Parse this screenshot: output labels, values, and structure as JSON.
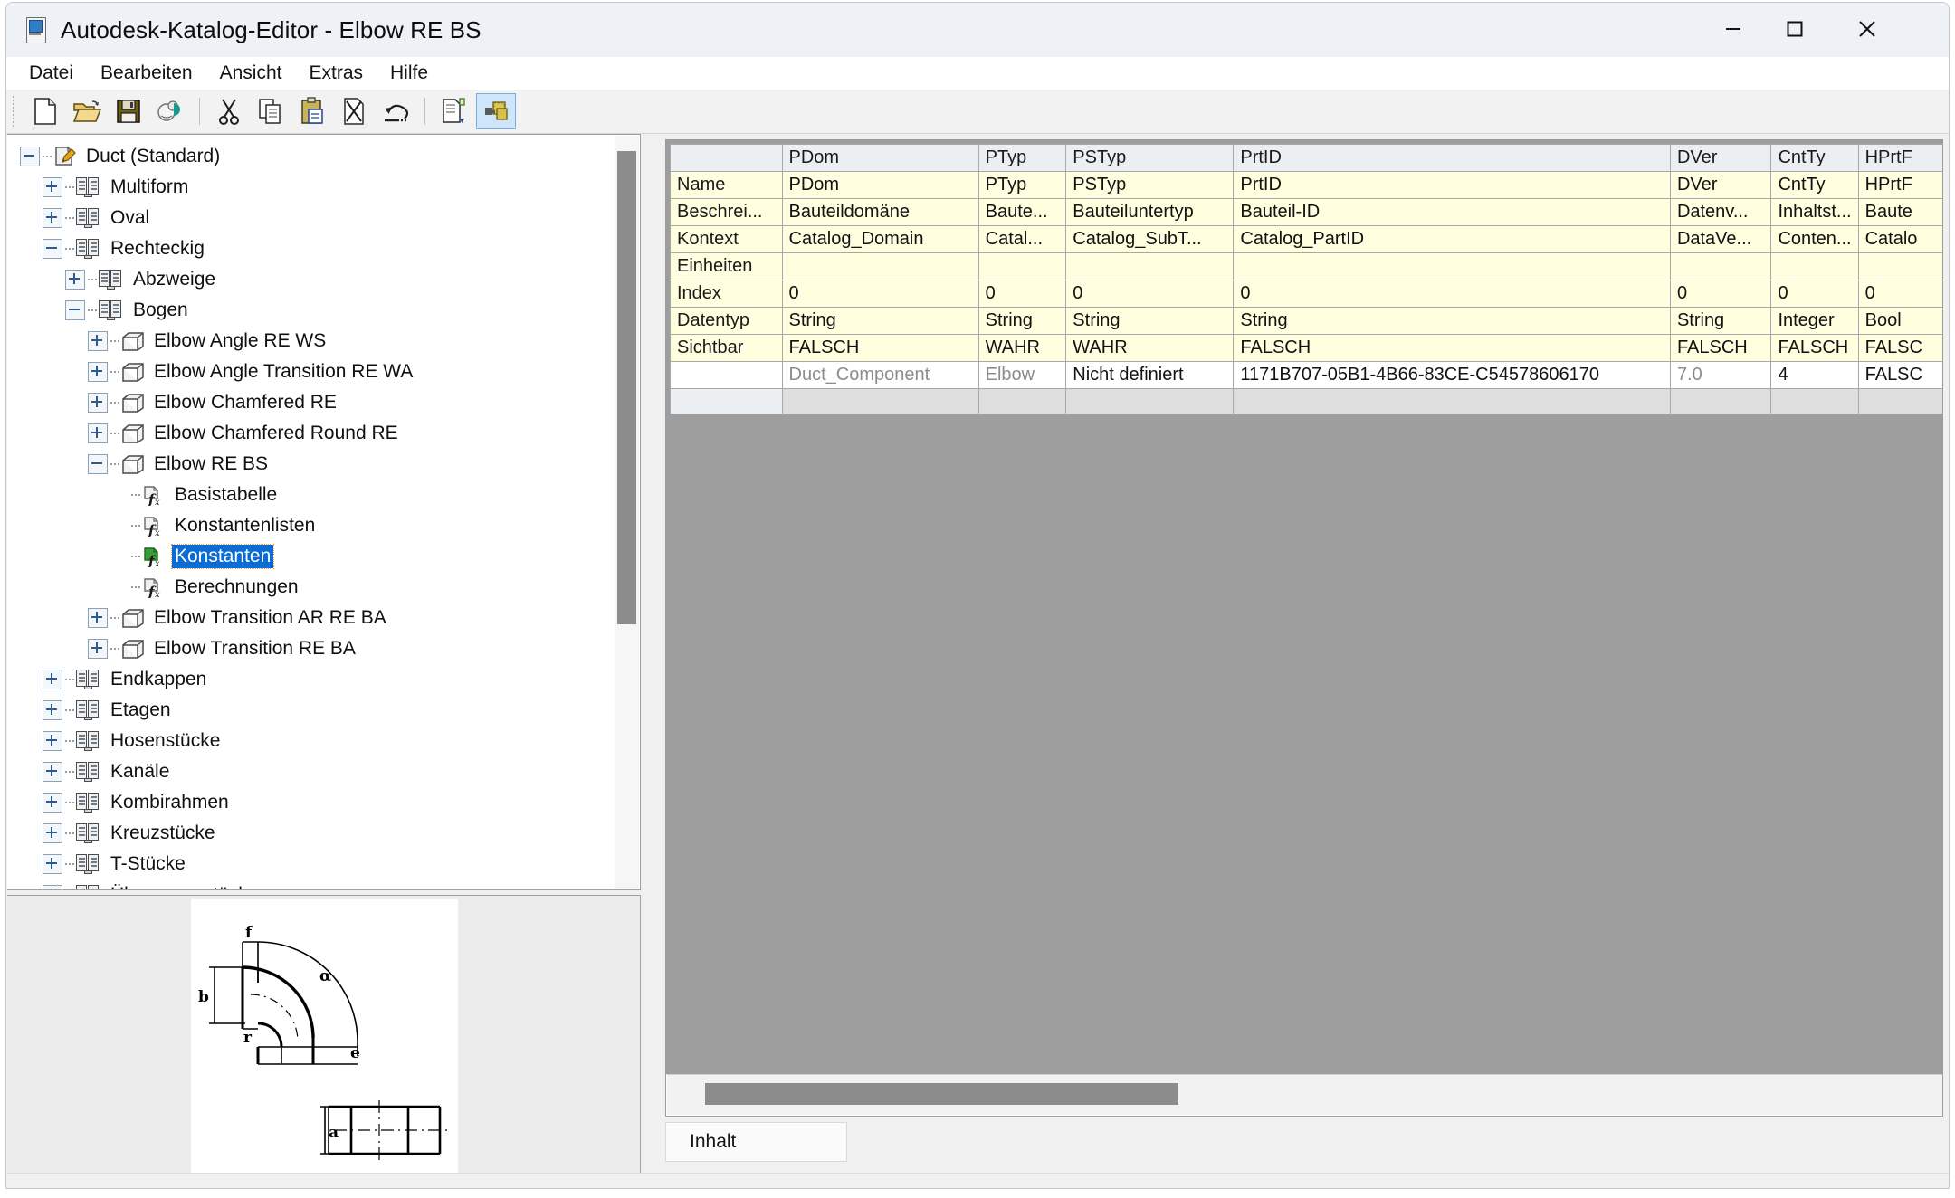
{
  "window": {
    "title": "Autodesk-Katalog-Editor - Elbow RE BS",
    "icon": "catalog-editor-icon",
    "minimize_label": "Minimieren",
    "maximize_label": "Maximieren",
    "close_label": "Schließen"
  },
  "menu": {
    "items": [
      {
        "label": "Datei"
      },
      {
        "label": "Bearbeiten"
      },
      {
        "label": "Ansicht"
      },
      {
        "label": "Extras"
      },
      {
        "label": "Hilfe"
      }
    ]
  },
  "toolbar": {
    "buttons": [
      {
        "icon": "new-document-icon",
        "active": false
      },
      {
        "icon": "open-folder-icon",
        "active": false
      },
      {
        "icon": "save-floppy-icon",
        "active": false
      },
      {
        "icon": "save-as-icon",
        "active": false
      },
      {
        "sep": true
      },
      {
        "icon": "cut-scissors-icon",
        "active": false
      },
      {
        "icon": "copy-icon",
        "active": false
      },
      {
        "icon": "paste-clipboard-icon",
        "active": false
      },
      {
        "icon": "delete-document-icon",
        "active": false
      },
      {
        "icon": "undo-arrow-icon",
        "active": false
      },
      {
        "sep": true
      },
      {
        "icon": "new-part-document-icon",
        "active": false
      },
      {
        "icon": "content-builder-icon",
        "active": true
      }
    ]
  },
  "tree": {
    "nodes": [
      {
        "label": "Duct (Standard)",
        "depth": 0,
        "state": "minus",
        "icon": "catalog-icon",
        "selected": false
      },
      {
        "label": "Multiform",
        "depth": 1,
        "state": "plus",
        "icon": "book-icon",
        "selected": false
      },
      {
        "label": "Oval",
        "depth": 1,
        "state": "plus",
        "icon": "book-icon",
        "selected": false
      },
      {
        "label": "Rechteckig",
        "depth": 1,
        "state": "minus",
        "icon": "book-icon",
        "selected": false
      },
      {
        "label": "Abzweige",
        "depth": 2,
        "state": "plus",
        "icon": "book-icon",
        "selected": false
      },
      {
        "label": "Bogen",
        "depth": 2,
        "state": "minus",
        "icon": "book-icon",
        "selected": false
      },
      {
        "label": "Elbow Angle RE WS",
        "depth": 3,
        "state": "plus",
        "icon": "cube-icon",
        "selected": false
      },
      {
        "label": "Elbow Angle Transition RE WA",
        "depth": 3,
        "state": "plus",
        "icon": "cube-icon",
        "selected": false
      },
      {
        "label": "Elbow Chamfered RE",
        "depth": 3,
        "state": "plus",
        "icon": "cube-icon",
        "selected": false
      },
      {
        "label": "Elbow Chamfered Round RE",
        "depth": 3,
        "state": "plus",
        "icon": "cube-icon",
        "selected": false
      },
      {
        "label": "Elbow RE BS",
        "depth": 3,
        "state": "minus",
        "icon": "cube-icon",
        "selected": false
      },
      {
        "label": "Basistabelle",
        "depth": 4,
        "state": "none",
        "icon": "fx-icon",
        "selected": false
      },
      {
        "label": "Konstantenlisten",
        "depth": 4,
        "state": "none",
        "icon": "fx-icon",
        "selected": false
      },
      {
        "label": "Konstanten",
        "depth": 4,
        "state": "none",
        "icon": "fx-icon-green",
        "selected": true
      },
      {
        "label": "Berechnungen",
        "depth": 4,
        "state": "none",
        "icon": "fx-icon",
        "selected": false
      },
      {
        "label": "Elbow Transition AR RE BA",
        "depth": 3,
        "state": "plus",
        "icon": "cube-icon",
        "selected": false
      },
      {
        "label": "Elbow Transition RE BA",
        "depth": 3,
        "state": "plus",
        "icon": "cube-icon",
        "selected": false
      },
      {
        "label": "Endkappen",
        "depth": 1,
        "state": "plus",
        "icon": "book-icon",
        "selected": false
      },
      {
        "label": "Etagen",
        "depth": 1,
        "state": "plus",
        "icon": "book-icon",
        "selected": false
      },
      {
        "label": "Hosenstücke",
        "depth": 1,
        "state": "plus",
        "icon": "book-icon",
        "selected": false
      },
      {
        "label": "Kanäle",
        "depth": 1,
        "state": "plus",
        "icon": "book-icon",
        "selected": false
      },
      {
        "label": "Kombirahmen",
        "depth": 1,
        "state": "plus",
        "icon": "book-icon",
        "selected": false
      },
      {
        "label": "Kreuzstücke",
        "depth": 1,
        "state": "plus",
        "icon": "book-icon",
        "selected": false
      },
      {
        "label": "T-Stücke",
        "depth": 1,
        "state": "plus",
        "icon": "book-icon",
        "selected": false
      },
      {
        "label": "Übergangsstücke",
        "depth": 1,
        "state": "plus",
        "icon": "book-icon",
        "selected": false
      }
    ]
  },
  "preview": {
    "name": "elbow-technical-drawing",
    "labels": {
      "f": "f",
      "b": "b",
      "r": "r",
      "alpha": "α",
      "e": "e",
      "a": "a"
    }
  },
  "grid": {
    "columns": [
      "",
      "PDom",
      "PTyp",
      "PSTyp",
      "PrtID",
      "DVer",
      "CntTy",
      "HPrtF"
    ],
    "rows": [
      {
        "type": "meta",
        "header": "Name",
        "cells": [
          "PDom",
          "PTyp",
          "PSTyp",
          "PrtID",
          "DVer",
          "CntTy",
          "HPrtF"
        ]
      },
      {
        "type": "meta",
        "header": "Beschrei...",
        "cells": [
          "Bauteildomäne",
          "Baute...",
          "Bauteiluntertyp",
          "Bauteil-ID",
          "Datenv...",
          "Inhaltst...",
          "Baute"
        ]
      },
      {
        "type": "meta",
        "header": "Kontext",
        "cells": [
          "Catalog_Domain",
          "Catal...",
          "Catalog_SubT...",
          "Catalog_PartID",
          "DataVe...",
          "Conten...",
          "Catalo"
        ]
      },
      {
        "type": "meta",
        "header": "Einheiten",
        "cells": [
          "",
          "",
          "",
          "",
          "",
          "",
          ""
        ]
      },
      {
        "type": "meta",
        "header": "Index",
        "cells": [
          "0",
          "0",
          "0",
          "0",
          "0",
          "0",
          "0"
        ]
      },
      {
        "type": "meta",
        "header": "Datentyp",
        "cells": [
          "String",
          "String",
          "String",
          "String",
          "String",
          "Integer",
          "Bool"
        ]
      },
      {
        "type": "meta",
        "header": "Sichtbar",
        "cells": [
          "FALSCH",
          "WAHR",
          "WAHR",
          "FALSCH",
          "FALSCH",
          "FALSCH",
          "FALSC"
        ]
      },
      {
        "type": "data",
        "header": "",
        "cells": [
          "Duct_Component",
          "Elbow",
          "Nicht definiert",
          "1171B707-05B1-4B66-83CE-C54578606170",
          "7.0",
          "4",
          "FALSC"
        ],
        "dim": [
          true,
          true,
          false,
          false,
          true,
          false,
          false
        ]
      },
      {
        "type": "empty",
        "header": "",
        "cells": [
          "",
          "",
          "",
          "",
          "",
          "",
          ""
        ]
      }
    ]
  },
  "tabs": {
    "items": [
      {
        "label": "Inhalt",
        "active": true
      }
    ]
  },
  "colors": {
    "selection_blue": "#0a6cd4",
    "meta_cell_yellow": "#ffffe0",
    "grid_background_gray": "#9e9e9e",
    "toolbar_active_blue": "#cfe6fa",
    "focus_outline_orange": "#e8a33d"
  }
}
